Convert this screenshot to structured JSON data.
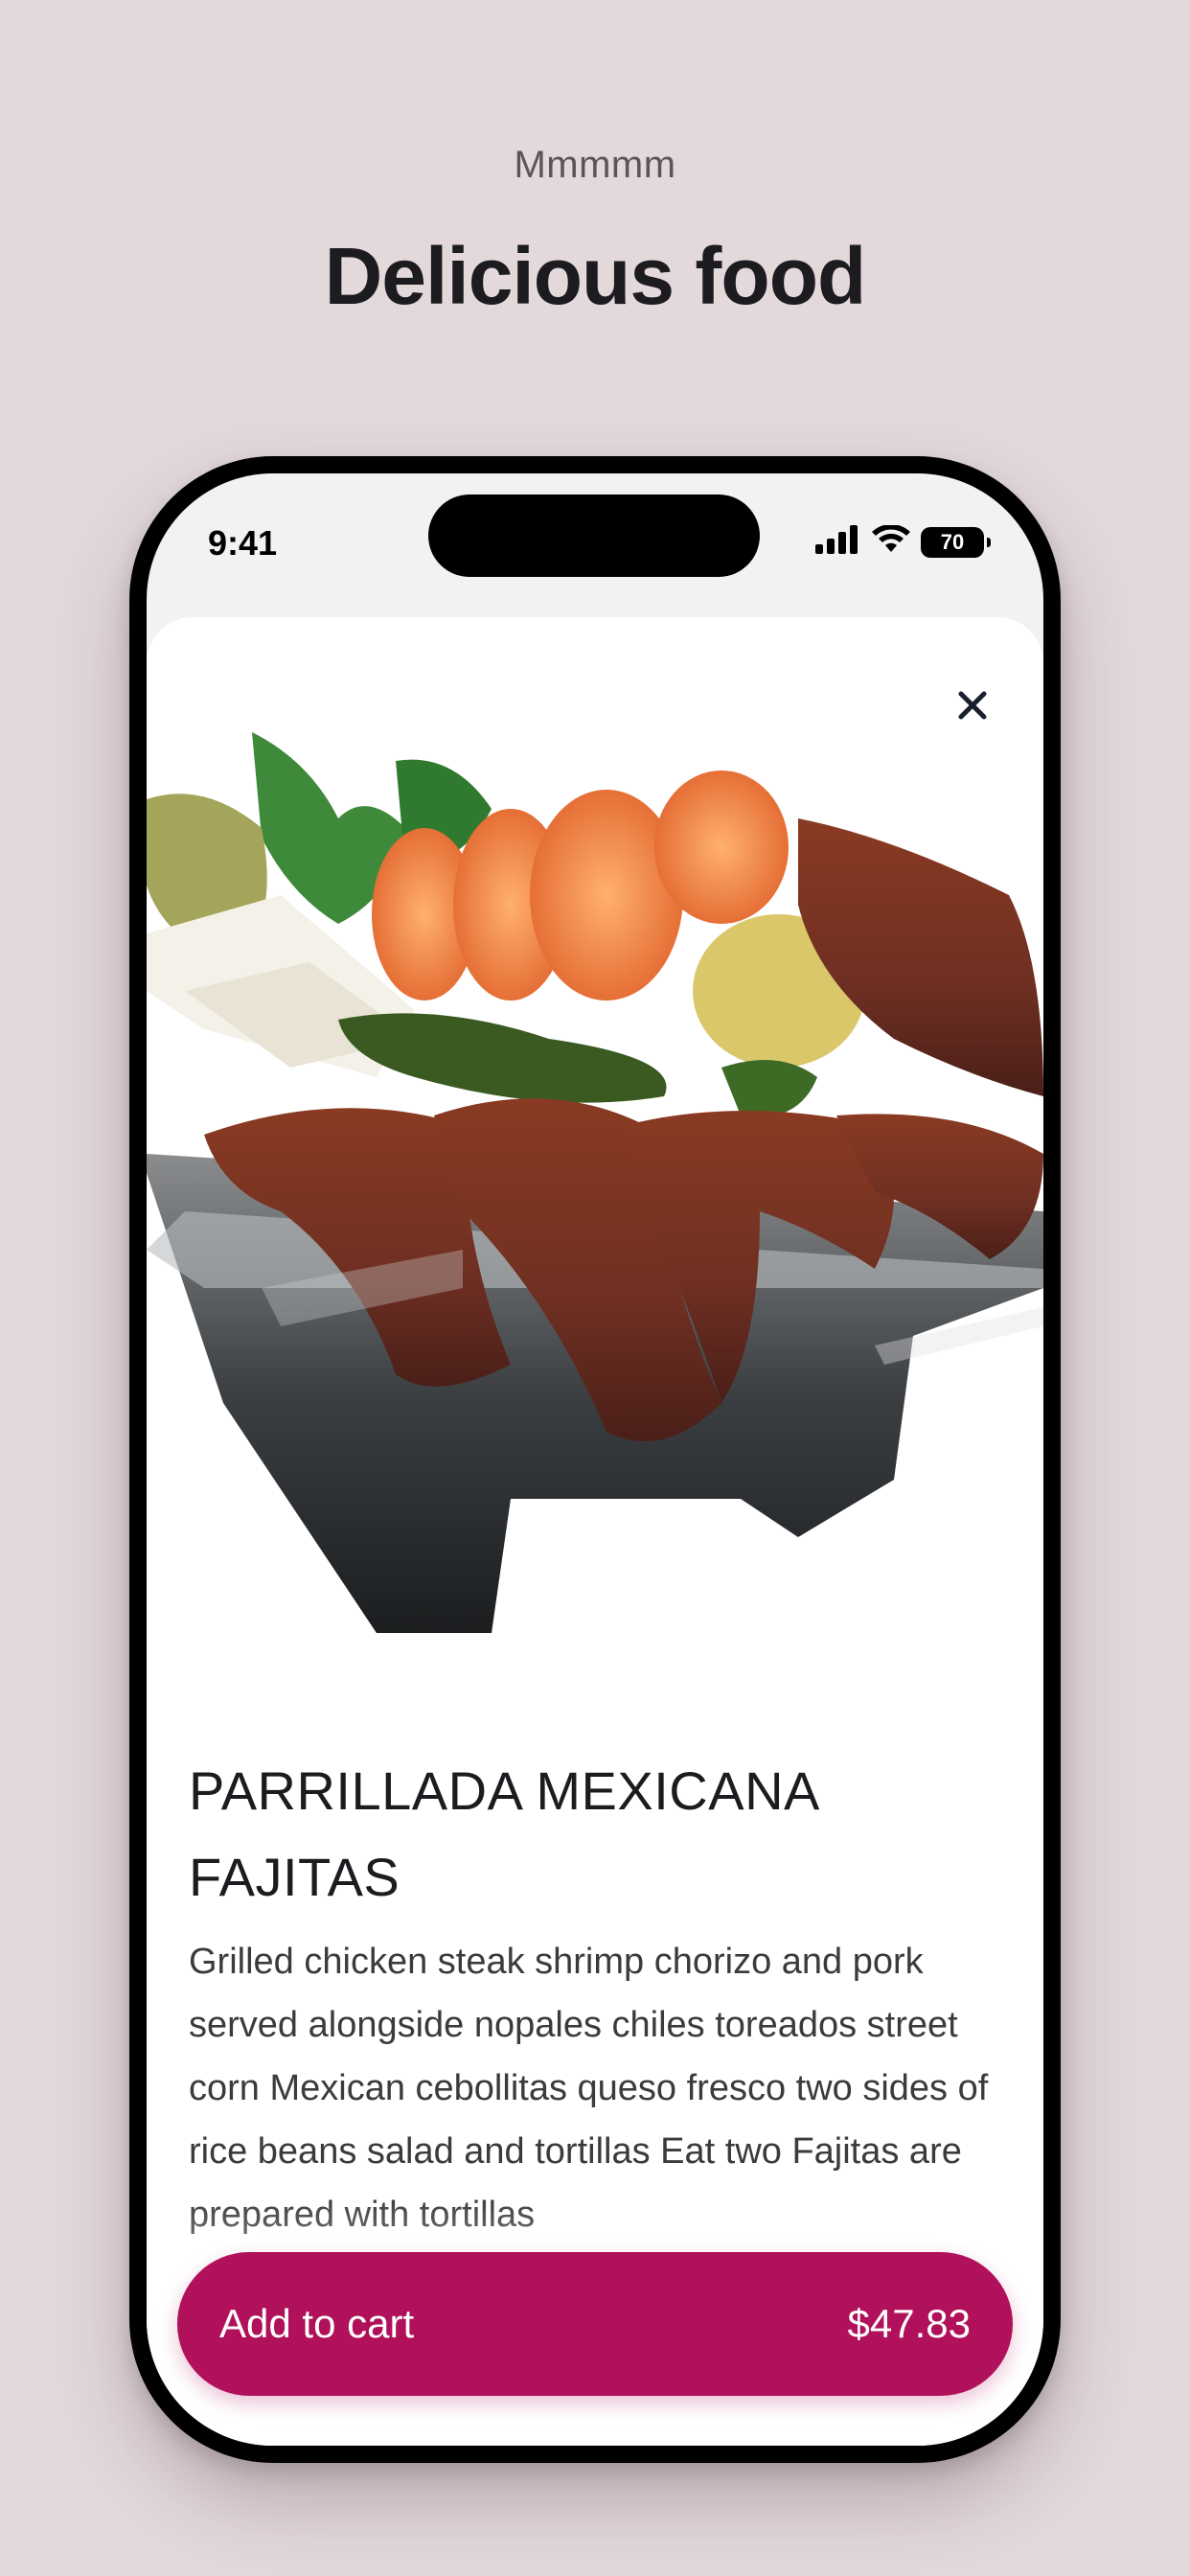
{
  "header": {
    "eyebrow": "Mmmmm",
    "title": "Delicious food"
  },
  "status_bar": {
    "time": "9:41",
    "battery": "70",
    "icons": [
      "cellular-signal-icon",
      "wifi-icon",
      "battery-icon"
    ]
  },
  "product": {
    "title": "PARRILLADA MEXICANA FAJITAS",
    "description": "Grilled chicken steak shrimp chorizo and pork served alongside nopales chiles toreados street corn Mexican cebollitas queso fresco two sides of rice beans salad and tortillas Eat two Fajitas are prepared with tortillas",
    "image_alt": "Mexican parrillada platter with grilled steak, shrimp, cheese, peppers and nopales",
    "close_icon": "close-icon"
  },
  "cart_button": {
    "label": "Add to cart",
    "price": "$47.83"
  },
  "colors": {
    "background": "#e3d9db",
    "accent": "#b0115a",
    "text": "#1c1b1f"
  }
}
